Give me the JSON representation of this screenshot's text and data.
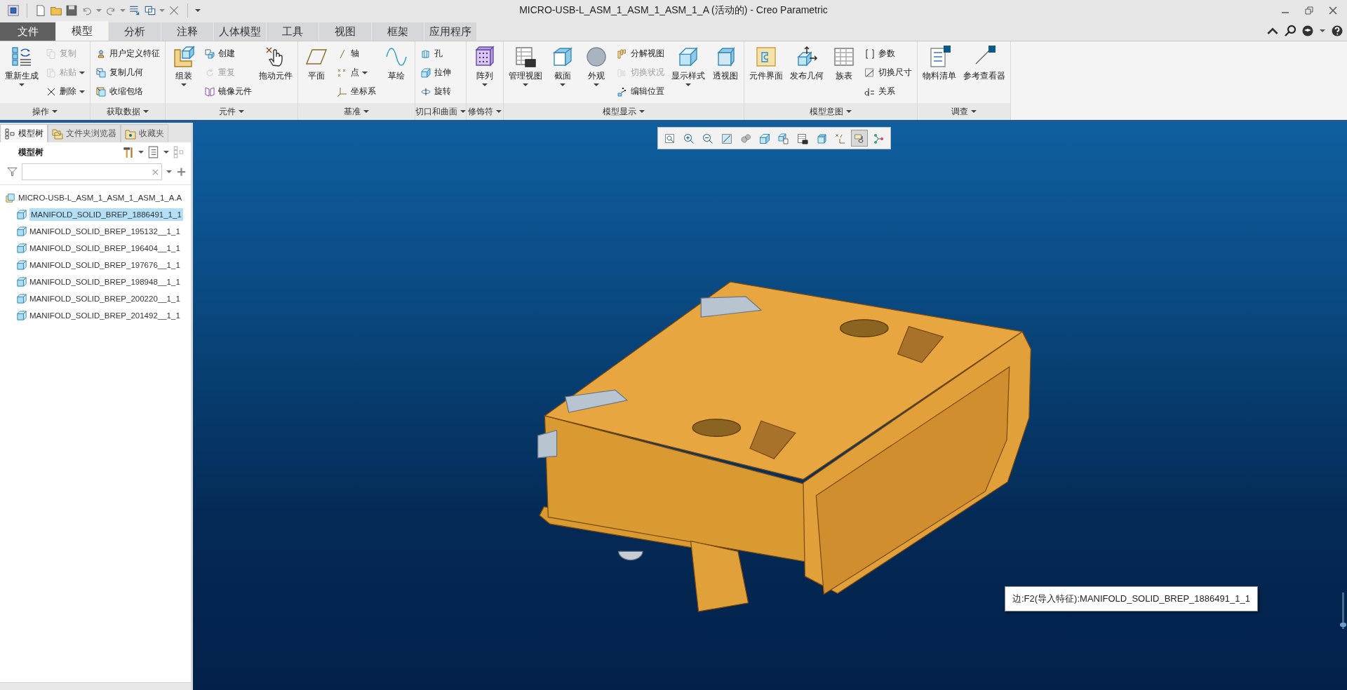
{
  "window": {
    "title": "MICRO-USB-L_ASM_1_ASM_1_ASM_1_A (活动的) - Creo Parametric"
  },
  "tabs": [
    {
      "label": "文件",
      "kind": "file",
      "selected": false
    },
    {
      "label": "模型",
      "kind": "tab",
      "selected": true
    },
    {
      "label": "分析",
      "kind": "tab",
      "selected": false
    },
    {
      "label": "注释",
      "kind": "tab",
      "selected": false
    },
    {
      "label": "人体模型",
      "kind": "tab",
      "selected": false
    },
    {
      "label": "工具",
      "kind": "tab",
      "selected": false
    },
    {
      "label": "视图",
      "kind": "tab",
      "selected": false
    },
    {
      "label": "框架",
      "kind": "tab",
      "selected": false
    },
    {
      "label": "应用程序",
      "kind": "tab",
      "selected": false
    }
  ],
  "ribbon": [
    {
      "label": "操作",
      "items": [
        {
          "label": "重新生成",
          "kind": "large",
          "disabled": false,
          "dropdown": true
        },
        {
          "label": "复制",
          "kind": "small",
          "disabled": true,
          "dropdown": false
        },
        {
          "label": "粘贴",
          "kind": "small",
          "disabled": true,
          "dropdown": true
        },
        {
          "label": "删除",
          "kind": "small",
          "disabled": false,
          "dropdown": true
        }
      ]
    },
    {
      "label": "获取数据",
      "items": [
        {
          "label": "用户定义特征",
          "kind": "small",
          "disabled": false,
          "dropdown": false
        },
        {
          "label": "复制几何",
          "kind": "small",
          "disabled": false,
          "dropdown": false
        },
        {
          "label": "收缩包络",
          "kind": "small",
          "disabled": false,
          "dropdown": false
        }
      ]
    },
    {
      "label": "元件",
      "items": [
        {
          "label": "组装",
          "kind": "large",
          "disabled": false,
          "dropdown": true
        },
        {
          "label": "创建",
          "kind": "small",
          "disabled": false,
          "dropdown": false
        },
        {
          "label": "重复",
          "kind": "small",
          "disabled": true,
          "dropdown": false
        },
        {
          "label": "镜像元件",
          "kind": "small",
          "disabled": false,
          "dropdown": false
        },
        {
          "label": "拖动元件",
          "kind": "large",
          "disabled": false,
          "dropdown": false
        }
      ]
    },
    {
      "label": "基准",
      "items": [
        {
          "label": "平面",
          "kind": "large",
          "disabled": false,
          "dropdown": false
        },
        {
          "label": "轴",
          "kind": "small",
          "disabled": false,
          "dropdown": false
        },
        {
          "label": "点",
          "kind": "small",
          "disabled": false,
          "dropdown": true
        },
        {
          "label": "坐标系",
          "kind": "small",
          "disabled": false,
          "dropdown": false
        },
        {
          "label": "草绘",
          "kind": "large",
          "disabled": false,
          "dropdown": false
        }
      ]
    },
    {
      "label": "切口和曲面",
      "items": [
        {
          "label": "孔",
          "kind": "small",
          "disabled": false,
          "dropdown": false
        },
        {
          "label": "拉伸",
          "kind": "small",
          "disabled": false,
          "dropdown": false
        },
        {
          "label": "旋转",
          "kind": "small",
          "disabled": false,
          "dropdown": false
        }
      ]
    },
    {
      "label": "修饰符",
      "items": [
        {
          "label": "阵列",
          "kind": "large",
          "disabled": false,
          "dropdown": true
        }
      ]
    },
    {
      "label": "模型显示",
      "items": [
        {
          "label": "管理视图",
          "kind": "large",
          "disabled": false,
          "dropdown": true
        },
        {
          "label": "截面",
          "kind": "large",
          "disabled": false,
          "dropdown": true
        },
        {
          "label": "外观",
          "kind": "large",
          "disabled": false,
          "dropdown": true
        },
        {
          "label": "分解视图",
          "kind": "small",
          "disabled": false,
          "dropdown": false
        },
        {
          "label": "切换状况",
          "kind": "small",
          "disabled": true,
          "dropdown": false
        },
        {
          "label": "编辑位置",
          "kind": "small",
          "disabled": false,
          "dropdown": false
        },
        {
          "label": "显示样式",
          "kind": "large",
          "disabled": false,
          "dropdown": true
        },
        {
          "label": "透视图",
          "kind": "large",
          "disabled": false,
          "dropdown": false
        }
      ]
    },
    {
      "label": "模型意图",
      "items": [
        {
          "label": "元件界面",
          "kind": "large",
          "disabled": false,
          "dropdown": false
        },
        {
          "label": "发布几何",
          "kind": "large",
          "disabled": false,
          "dropdown": false
        },
        {
          "label": "族表",
          "kind": "large",
          "disabled": false,
          "dropdown": false
        },
        {
          "label": "参数",
          "kind": "small",
          "disabled": false,
          "dropdown": false
        },
        {
          "label": "切换尺寸",
          "kind": "small",
          "disabled": false,
          "dropdown": false
        },
        {
          "label": "关系",
          "kind": "small",
          "disabled": false,
          "dropdown": false
        }
      ]
    },
    {
      "label": "调查",
      "items": [
        {
          "label": "物料清单",
          "kind": "large",
          "disabled": false,
          "dropdown": false
        },
        {
          "label": "参考查看器",
          "kind": "large",
          "disabled": false,
          "dropdown": false
        }
      ]
    }
  ],
  "panel": {
    "tabs": [
      {
        "label": "模型树",
        "selected": true
      },
      {
        "label": "文件夹浏览器",
        "selected": false
      },
      {
        "label": "收藏夹",
        "selected": false
      }
    ],
    "header": "模型树",
    "tree": {
      "label": "MICRO-USB-L_ASM_1_ASM_1_ASM_1_A.A",
      "selected": false,
      "children": [
        {
          "label": "MANIFOLD_SOLID_BREP_1886491_1_1",
          "selected": true
        },
        {
          "label": "MANIFOLD_SOLID_BREP_195132__1_1",
          "selected": false
        },
        {
          "label": "MANIFOLD_SOLID_BREP_196404__1_1",
          "selected": false
        },
        {
          "label": "MANIFOLD_SOLID_BREP_197676__1_1",
          "selected": false
        },
        {
          "label": "MANIFOLD_SOLID_BREP_198948__1_1",
          "selected": false
        },
        {
          "label": "MANIFOLD_SOLID_BREP_200220__1_1",
          "selected": false
        },
        {
          "label": "MANIFOLD_SOLID_BREP_201492__1_1",
          "selected": false
        }
      ]
    }
  },
  "view_toolbar": [
    {
      "pressed": false
    },
    {
      "pressed": false
    },
    {
      "pressed": false
    },
    {
      "pressed": false
    },
    {
      "pressed": false
    },
    {
      "pressed": false
    },
    {
      "pressed": false
    },
    {
      "pressed": false
    },
    {
      "pressed": false
    },
    {
      "pressed": false
    },
    {
      "pressed": true
    },
    {
      "pressed": false
    }
  ],
  "view_slider": {
    "level": 0.05
  },
  "tooltip": "边:F2(导入特征):MANIFOLD_SOLID_BREP_1886491_1_1"
}
